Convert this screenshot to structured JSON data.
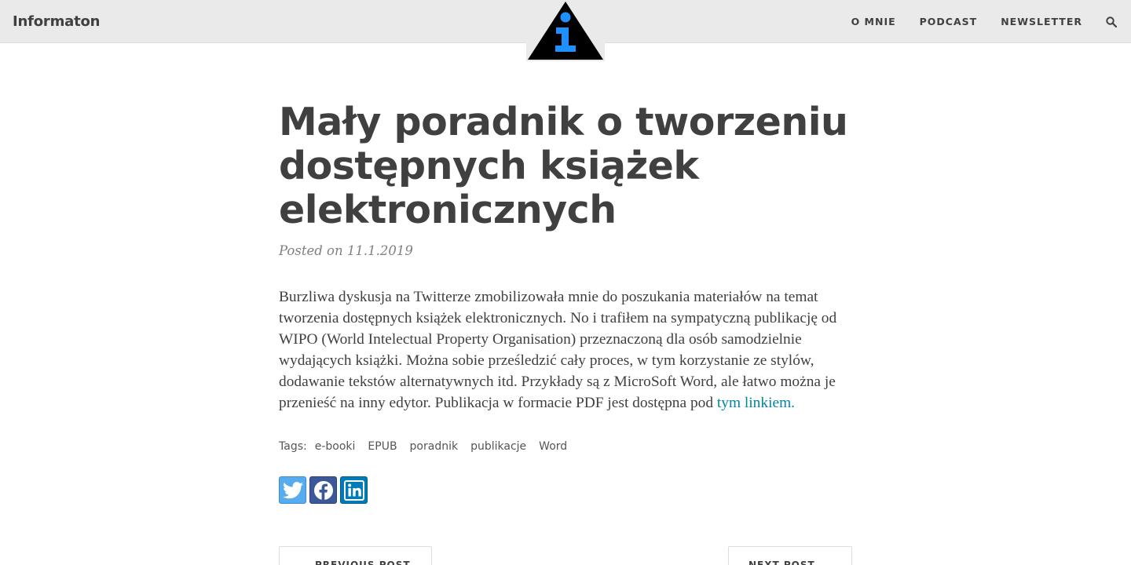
{
  "header": {
    "brand": "Informaton",
    "nav": [
      "O MNIE",
      "PODCAST",
      "NEWSLETTER"
    ],
    "search_icon": "search-icon",
    "logo_icon": "info-triangle-logo"
  },
  "post": {
    "title": "Mały poradnik o tworzeniu dostępnych książek elektronicznych",
    "meta": "Posted on 11.1.2019",
    "body_text": "Burzliwa dyskusja na Twitterze zmobilizowała mnie do poszukania materiałów na temat tworzenia dostępnych książek elektronicznych. No i trafiłem na sympatyczną publikację od WIPO (World Intelectual Property Organisation) przeznaczoną dla osób samodzielnie wydających książki. Można sobie prześledzić cały proces, w tym korzystanie ze stylów, dodawanie tekstów alternatywnych itd. Przykłady są z MicroSoft Word, ale łatwo można je przenieść na inny edytor. Publikacja w formacie PDF jest dostępna pod ",
    "body_link": "tym linkiem."
  },
  "tags": {
    "label": "Tags:",
    "items": [
      "e-booki",
      "EPUB",
      "poradnik",
      "publikacje",
      "Word"
    ]
  },
  "share": {
    "icons": [
      "twitter-icon",
      "facebook-icon",
      "linkedin-icon"
    ],
    "colors": {
      "twitter": "#55acee",
      "facebook": "#3b5998",
      "linkedin": "#007bb5"
    }
  },
  "pager": {
    "previous": "PREVIOUS POST",
    "next": "NEXT POST"
  },
  "colors": {
    "navbar_bg": "#eaeaea",
    "text": "#404040",
    "link": "#0085a1",
    "logo_blue": "#1e90ff"
  }
}
